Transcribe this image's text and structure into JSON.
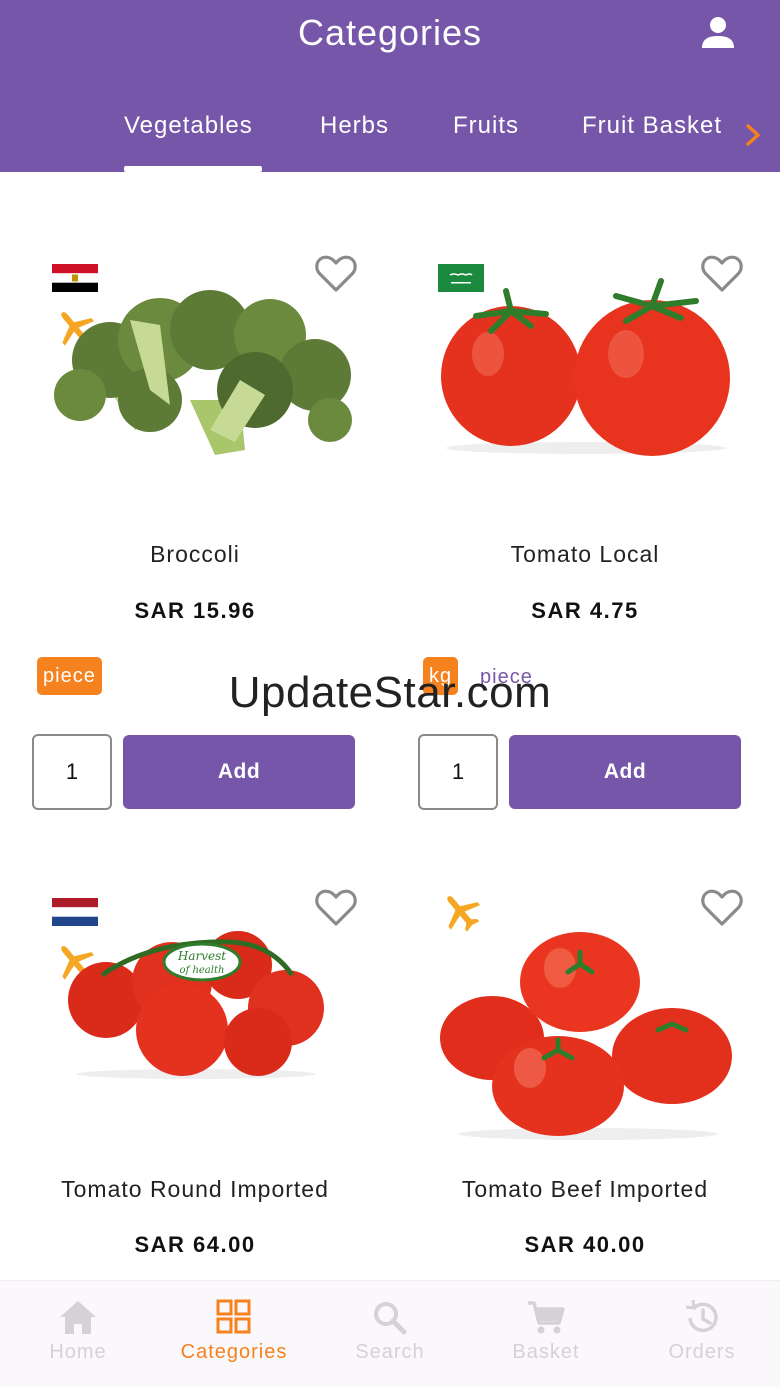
{
  "header": {
    "title": "Categories",
    "user_icon": "user-icon",
    "tabs": [
      {
        "label": "Vegetables",
        "active": true
      },
      {
        "label": "Herbs",
        "active": false
      },
      {
        "label": "Fruits",
        "active": false
      },
      {
        "label": "Fruit Basket",
        "active": false
      }
    ],
    "next_icon": "chevron-right-icon"
  },
  "products": [
    {
      "name": "Broccoli",
      "price": "SAR 15.96",
      "origin_flag": "egypt-flag",
      "imported_icon": "airplane-icon",
      "units": [
        "piece"
      ],
      "selected_unit": "piece",
      "quantity": "1",
      "add_label": "Add"
    },
    {
      "name": "Tomato Local",
      "price": "SAR 4.75",
      "origin_flag": "saudi-arabia-flag",
      "units": [
        "kg",
        "piece"
      ],
      "selected_unit": "kg",
      "quantity": "1",
      "add_label": "Add"
    },
    {
      "name": "Tomato Round Imported",
      "price": "SAR 64.00",
      "origin_flag": "netherlands-flag",
      "imported_icon": "airplane-icon",
      "image_label": [
        "Harvest",
        "of health"
      ]
    },
    {
      "name": "Tomato Beef Imported",
      "price": "SAR 40.00",
      "imported_icon": "airplane-icon"
    }
  ],
  "watermark": "UpdateStar.com",
  "bottom_nav": [
    {
      "label": "Home",
      "icon": "home-icon",
      "active": false
    },
    {
      "label": "Categories",
      "icon": "grid-icon",
      "active": true
    },
    {
      "label": "Search",
      "icon": "search-icon",
      "active": false
    },
    {
      "label": "Basket",
      "icon": "cart-icon",
      "active": false
    },
    {
      "label": "Orders",
      "icon": "history-icon",
      "active": false
    }
  ],
  "colors": {
    "brand_purple": "#7656a8",
    "accent_orange": "#f5811f",
    "plane_yellow": "#f5a623"
  }
}
